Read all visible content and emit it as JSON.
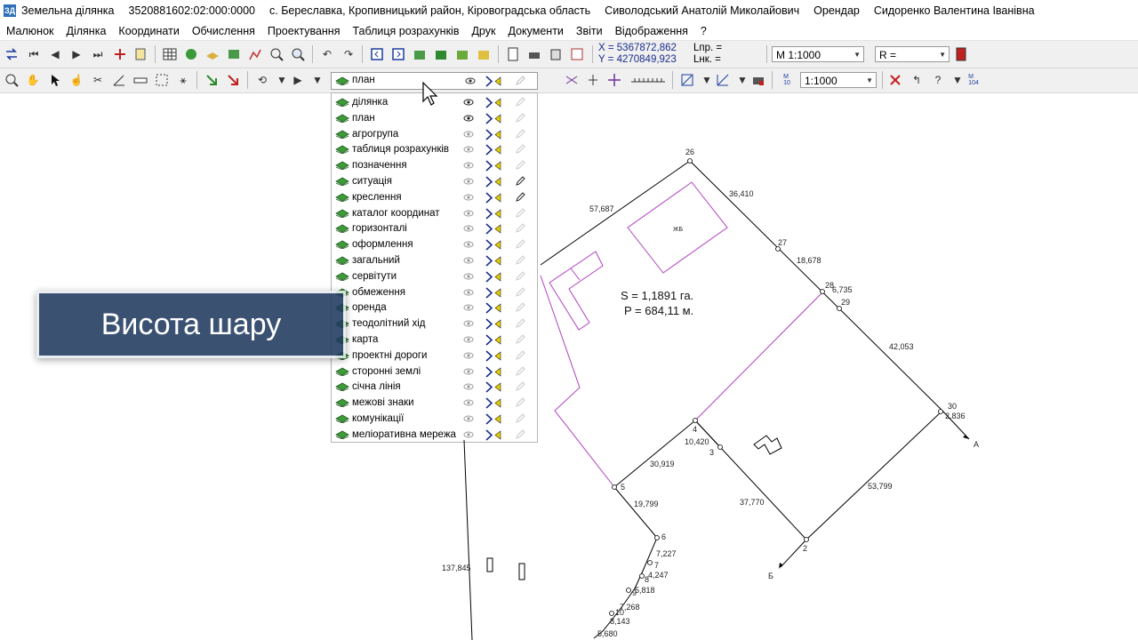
{
  "titlebar": {
    "app_name": "Земельна ділянка",
    "cadastral_number": "3520881602:02:000:0000",
    "location": "с. Береславка, Кропивницький район, Кіровоградська область",
    "owner": "Сиволодський Анатолій Миколайович",
    "role": "Орендар",
    "tenant": "Сидоренко Валентина Іванівна"
  },
  "menu": [
    "Малюнок",
    "Ділянка",
    "Координати",
    "Обчислення",
    "Проектування",
    "Таблиця розрахунків",
    "Друк",
    "Документи",
    "Звіти",
    "Відображення",
    "?"
  ],
  "toolbar1": {
    "x_coord": "X = 5367872,862",
    "y_coord": "Y = 4270849,923",
    "lnp": "Lпр. =",
    "lnk": "Lнк. =",
    "scale": "М 1:1000",
    "r_label": "R ="
  },
  "toolbar2": {
    "layer_selected": "план",
    "scale2": "1:1000"
  },
  "layers": [
    {
      "name": "ділянка",
      "visible": true,
      "pen": false
    },
    {
      "name": "план",
      "visible": true,
      "pen": false
    },
    {
      "name": "агрогрупа",
      "visible": false,
      "pen": false
    },
    {
      "name": "таблиця розрахунків",
      "visible": false,
      "pen": false
    },
    {
      "name": "позначення",
      "visible": false,
      "pen": false
    },
    {
      "name": "ситуація",
      "visible": false,
      "pen": true
    },
    {
      "name": "креслення",
      "visible": false,
      "pen": true
    },
    {
      "name": "каталог координат",
      "visible": false,
      "pen": false
    },
    {
      "name": "горизонталі",
      "visible": false,
      "pen": false
    },
    {
      "name": "оформлення",
      "visible": false,
      "pen": false
    },
    {
      "name": "загальний",
      "visible": false,
      "pen": false
    },
    {
      "name": "сервітути",
      "visible": false,
      "pen": false
    },
    {
      "name": "обмеження",
      "visible": false,
      "pen": false
    },
    {
      "name": "оренда",
      "visible": false,
      "pen": false
    },
    {
      "name": "теодолітний хід",
      "visible": false,
      "pen": false
    },
    {
      "name": "карта",
      "visible": false,
      "pen": false
    },
    {
      "name": "проектні дороги",
      "visible": false,
      "pen": false
    },
    {
      "name": "сторонні землі",
      "visible": false,
      "pen": false
    },
    {
      "name": "січна лінія",
      "visible": false,
      "pen": false
    },
    {
      "name": "межові знаки",
      "visible": false,
      "pen": false
    },
    {
      "name": "комунікації",
      "visible": false,
      "pen": false
    },
    {
      "name": "меліоративна мережа",
      "visible": false,
      "pen": false
    }
  ],
  "overlay": {
    "text": "Висота шару"
  },
  "drawing": {
    "area_text": "S = 1,1891 га.",
    "perimeter_text": "P = 684,11 м.",
    "building_label": "ЖБ",
    "points": [
      "26",
      "27",
      "28",
      "29",
      "30",
      "4",
      "3",
      "5",
      "6",
      "7",
      "8",
      "9",
      "10",
      "2"
    ],
    "lengths": [
      "57,687",
      "36,410",
      "18,678",
      "6,735",
      "42,053",
      "2,836",
      "10,420",
      "30,919",
      "19,799",
      "37,770",
      "53,799",
      "7,227",
      "4,247",
      "5,818",
      "7,268",
      "8,143",
      "5,680",
      "137,845"
    ],
    "arrow_labels": [
      "А",
      "Б"
    ]
  },
  "colors": {
    "parcel_line": "#000000",
    "plan_line": "#b040c0",
    "overlay_bg": "#1f3a5f",
    "coord_text": "#1a2c8a",
    "layer_icon": "#3f9a3a"
  }
}
